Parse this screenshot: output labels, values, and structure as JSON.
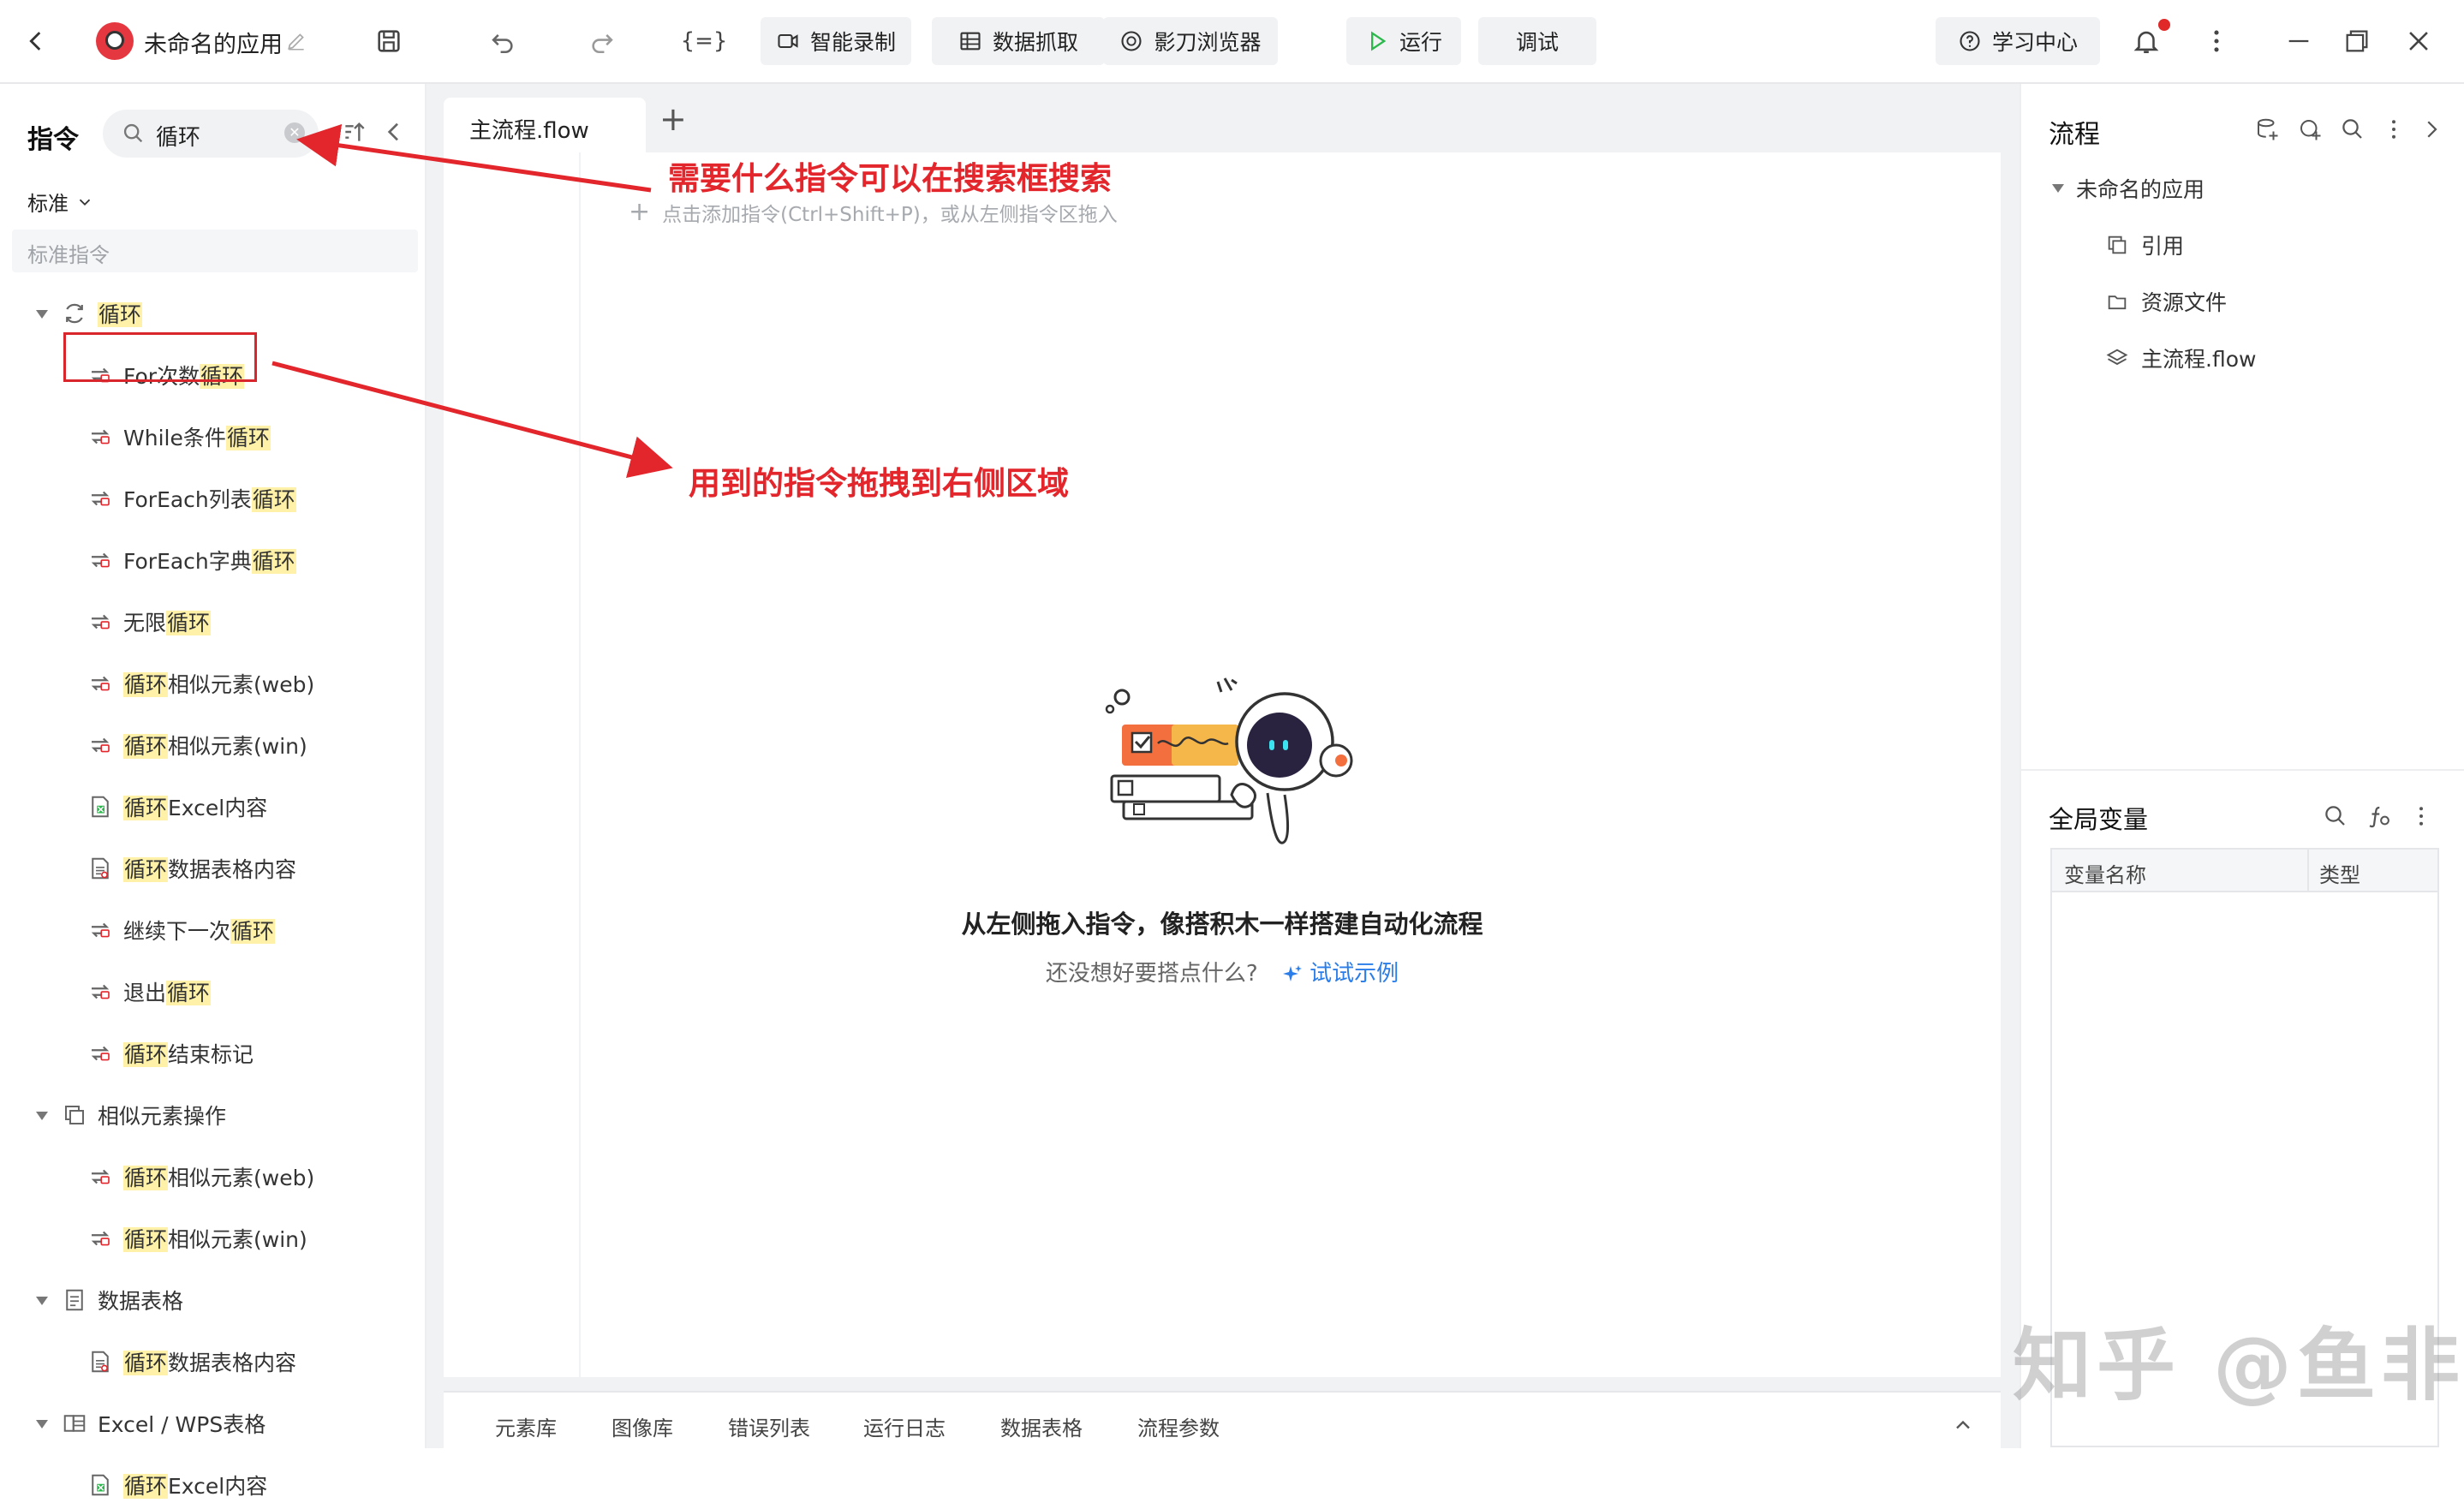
{
  "topbar": {
    "app_name": "未命名的应用",
    "buttons": {
      "smart_record": "智能录制",
      "data_capture": "数据抓取",
      "browser": "影刀浏览器",
      "run": "运行",
      "debug": "调试",
      "learning_center": "学习中心"
    },
    "variable_icon": "{=}"
  },
  "left_panel": {
    "title": "指令",
    "search": {
      "value": "循环",
      "highlight": "循环"
    },
    "category_dropdown": "标准",
    "section_label": "标准指令",
    "groups": [
      {
        "name": "循环",
        "items": [
          "For次数循环",
          "While条件循环",
          "ForEach列表循环",
          "ForEach字典循环",
          "无限循环",
          "循环相似元素(web)",
          "循环相似元素(win)",
          "循环Excel内容",
          "循环数据表格内容",
          "继续下一次循环",
          "退出循环",
          "循环结束标记"
        ]
      },
      {
        "name": "相似元素操作",
        "items": [
          "循环相似元素(web)",
          "循环相似元素(win)"
        ]
      },
      {
        "name": "数据表格",
        "items": [
          "循环数据表格内容"
        ]
      },
      {
        "name": "Excel / WPS表格",
        "items": [
          "循环Excel内容"
        ]
      }
    ]
  },
  "center": {
    "tab_name": "主流程.flow",
    "add_hint": "点击添加指令(Ctrl+Shift+P)，或从左侧指令区拖入",
    "empty_title": "从左侧拖入指令，像搭积木一样搭建自动化流程",
    "empty_subtitle": "还没想好要搭点什么?",
    "example_link": "试试示例",
    "bottom_tabs": [
      "元素库",
      "图像库",
      "错误列表",
      "运行日志",
      "数据表格",
      "流程参数"
    ]
  },
  "right_panel": {
    "flow_title": "流程",
    "tree": {
      "root": "未命名的应用",
      "children": [
        "引用",
        "资源文件",
        "主流程.flow"
      ]
    },
    "global_vars_title": "全局变量",
    "table_headers": [
      "变量名称",
      "类型"
    ]
  },
  "annotations": {
    "search_note": "需要什么指令可以在搜索框搜索",
    "drag_note": "用到的指令拖拽到右侧区域"
  },
  "watermark": "知乎 @鱼非",
  "colors": {
    "annotation_red": "#e2262c",
    "highlight": "#fff2a8",
    "link_blue": "#2b7de9",
    "run_green": "#2db84d",
    "notification_red": "#e02828"
  }
}
